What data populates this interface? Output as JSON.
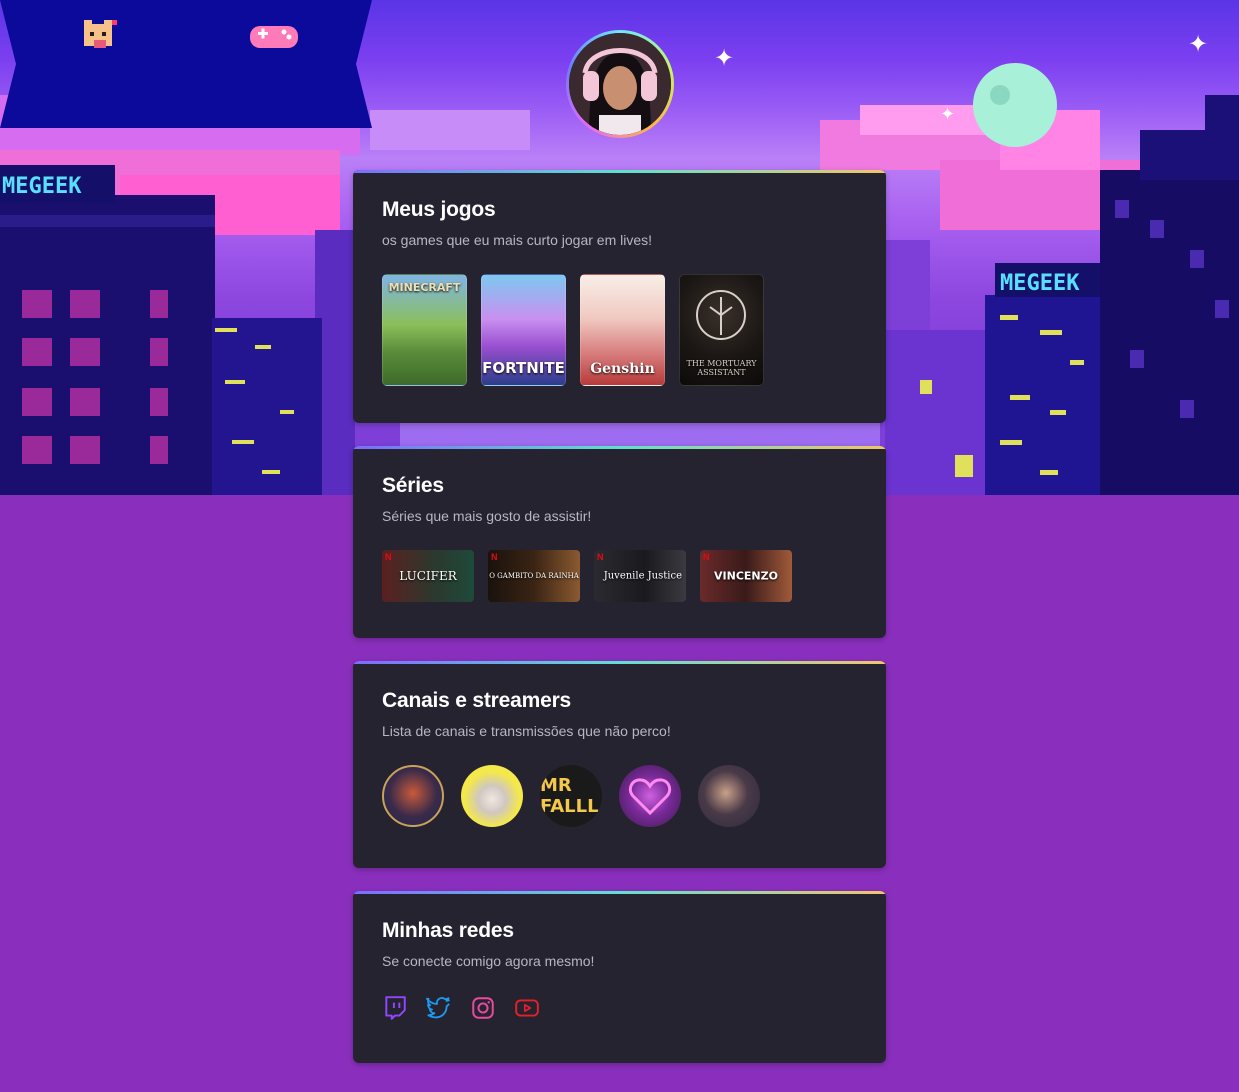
{
  "banner": {
    "sign_text": "MEGEEK"
  },
  "profile": {
    "avatar_icon": "streamer-avatar"
  },
  "games_section": {
    "title": "Meus jogos",
    "subtitle": "os games que eu mais curto jogar em lives!",
    "items": [
      {
        "name": "MINECRAFT",
        "colors": [
          "#7fb4e6",
          "#5a8c3a",
          "#3e6b2a"
        ]
      },
      {
        "name": "FORTNITE",
        "colors": [
          "#7ec8f0",
          "#9a4fd0",
          "#2b3d8a"
        ]
      },
      {
        "name": "Genshin",
        "colors": [
          "#f8efe8",
          "#e0a0a0",
          "#b83a3a"
        ]
      },
      {
        "name": "THE MORTUARY ASSISTANT",
        "colors": [
          "#1a1614",
          "#2b2420",
          "#0d0b0a"
        ]
      }
    ]
  },
  "series_section": {
    "title": "Séries",
    "subtitle": "Séries que mais gosto de assistir!",
    "items": [
      {
        "name": "LUCIFER",
        "colors": [
          "#3a2020",
          "#1e3a2e"
        ]
      },
      {
        "name": "O GAMBITO DA RAINHA",
        "colors": [
          "#2a1a10",
          "#6b4020"
        ]
      },
      {
        "name": "Juvenile Justice",
        "colors": [
          "#1a1a1e",
          "#3a3a40"
        ]
      },
      {
        "name": "VINCENZO",
        "colors": [
          "#3a1a1a",
          "#7a3a2a"
        ]
      }
    ]
  },
  "channels_section": {
    "title": "Canais e streamers",
    "subtitle": "Lista de canais e transmissões que não perco!",
    "items": [
      {
        "name": "channel-1",
        "bg": "#1e2a4a",
        "ring": "#c9a25a"
      },
      {
        "name": "channel-2",
        "bg": "#f4e84a",
        "ring": "#f4e84a"
      },
      {
        "name": "MR FALLL",
        "bg": "#1a1a1a",
        "ring": "#1a1a1a"
      },
      {
        "name": "channel-4",
        "bg": "#5a1a6a",
        "ring": "#3a1a4a"
      },
      {
        "name": "channel-5",
        "bg": "#2a2a3a",
        "ring": "#2a2a3a"
      }
    ]
  },
  "socials_section": {
    "title": "Minhas redes",
    "subtitle": "Se conecte comigo agora mesmo!",
    "items": [
      {
        "icon": "twitch-icon",
        "color": "#9146ff"
      },
      {
        "icon": "twitter-icon",
        "color": "#1d9bf0"
      },
      {
        "icon": "instagram-icon",
        "color": "#e1306c"
      },
      {
        "icon": "youtube-icon",
        "color": "#ff0000"
      }
    ]
  }
}
